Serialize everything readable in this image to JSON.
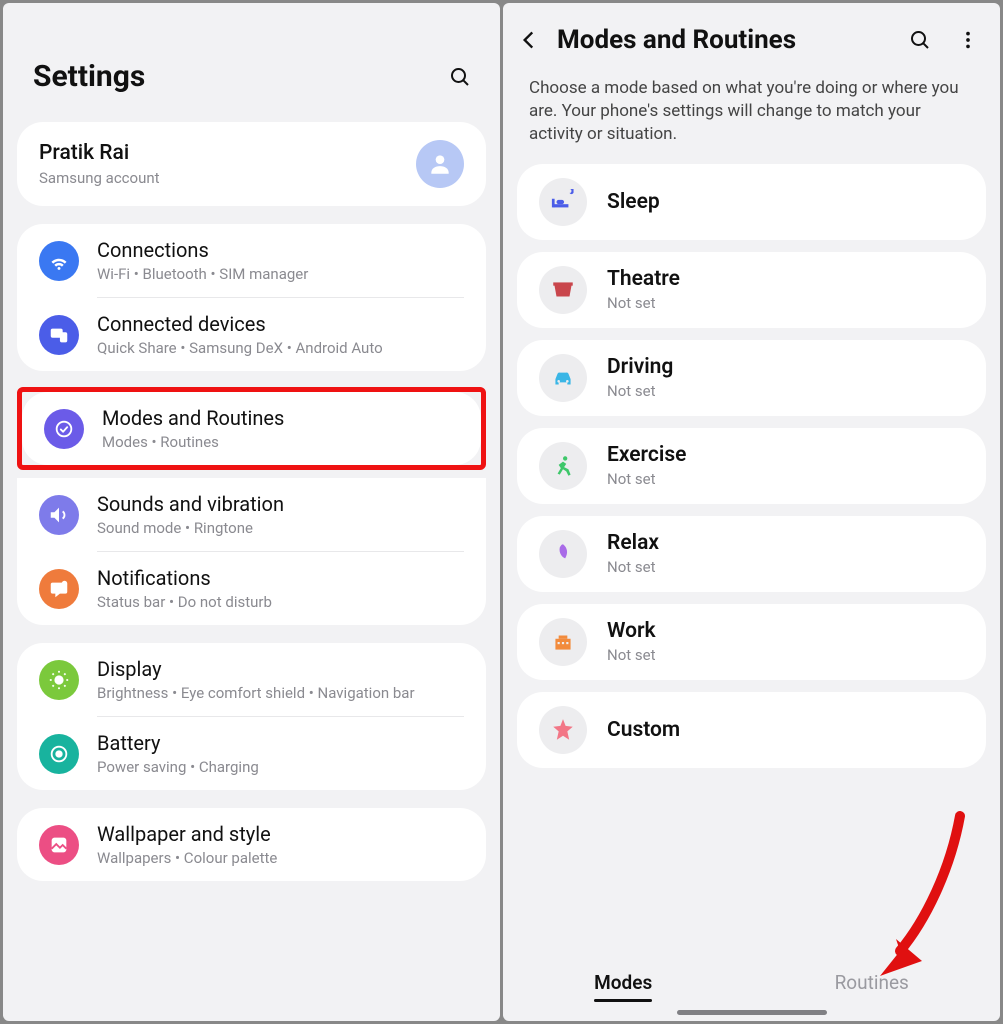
{
  "left": {
    "title": "Settings",
    "account": {
      "name": "Pratik Rai",
      "sub": "Samsung account"
    },
    "group1": {
      "connections": {
        "title": "Connections",
        "sub": "Wi-Fi  •  Bluetooth  •  SIM manager"
      },
      "devices": {
        "title": "Connected devices",
        "sub": "Quick Share  •  Samsung DeX  •  Android Auto"
      }
    },
    "group2": {
      "modes": {
        "title": "Modes and Routines",
        "sub": "Modes  •  Routines"
      },
      "sound": {
        "title": "Sounds and vibration",
        "sub": "Sound mode  •  Ringtone"
      },
      "notif": {
        "title": "Notifications",
        "sub": "Status bar  •  Do not disturb"
      }
    },
    "group3": {
      "display": {
        "title": "Display",
        "sub": "Brightness  •  Eye comfort shield  •  Navigation bar"
      },
      "battery": {
        "title": "Battery",
        "sub": "Power saving  •  Charging"
      }
    },
    "group4": {
      "wallpaper": {
        "title": "Wallpaper and style",
        "sub": "Wallpapers  •  Colour palette"
      }
    }
  },
  "right": {
    "title": "Modes and Routines",
    "desc": "Choose a mode based on what you're doing or where you are. Your phone's settings will change to match your activity or situation.",
    "notset": "Not set",
    "modes": {
      "sleep": "Sleep",
      "theatre": "Theatre",
      "driving": "Driving",
      "exercise": "Exercise",
      "relax": "Relax",
      "work": "Work",
      "custom": "Custom"
    },
    "tabs": {
      "modes": "Modes",
      "routines": "Routines"
    }
  }
}
